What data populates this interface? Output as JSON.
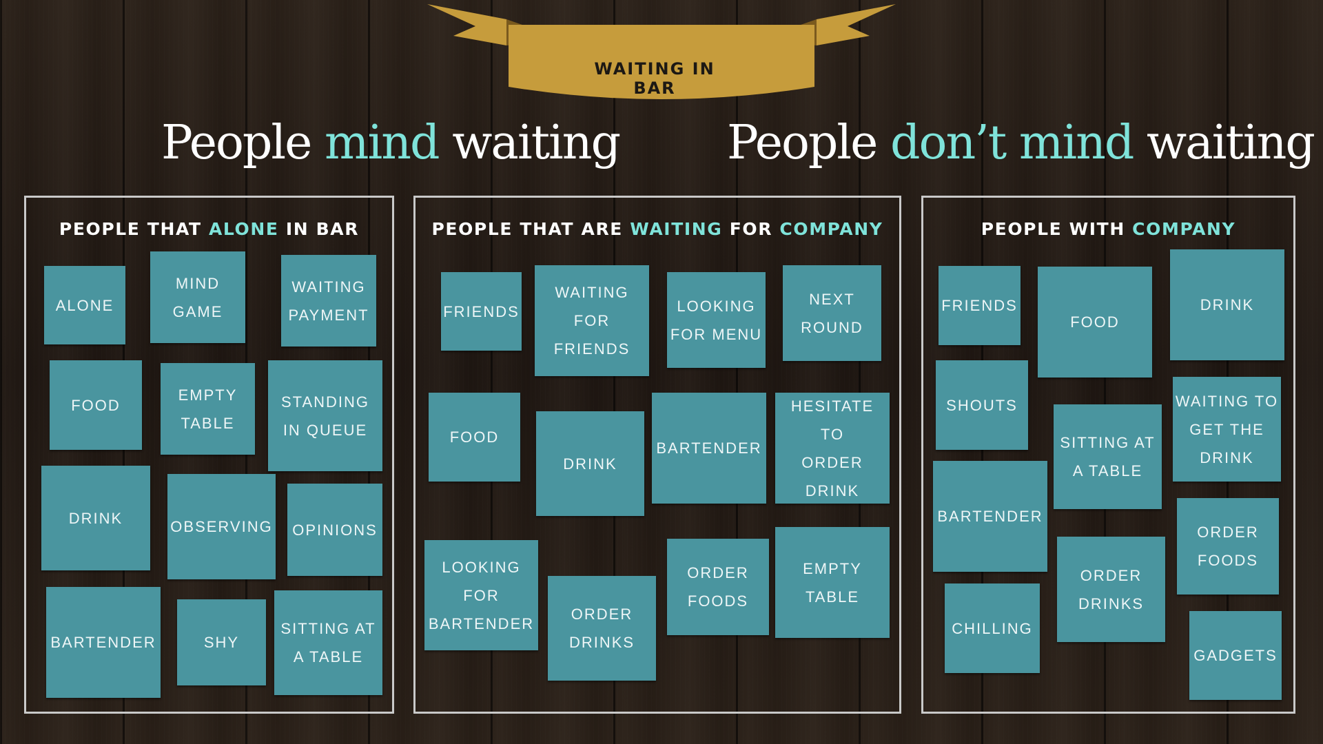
{
  "banner": {
    "label": "WAITING IN BAR",
    "color": "#c69c3c"
  },
  "headlines": {
    "left": {
      "before": "People",
      "accent": "mind",
      "after": "waiting"
    },
    "right": {
      "before": "People",
      "accent": "don’t mind",
      "after": "waiting"
    }
  },
  "colors": {
    "accent": "#7fe3da",
    "note": "#4a959f",
    "border": "#c9c9c9"
  },
  "panels": [
    {
      "title": [
        "PEOPLE THAT ",
        "ALONE",
        " IN BAR"
      ],
      "notes": [
        [
          "ALONE"
        ],
        [
          "MIND",
          "GAME"
        ],
        [
          "WAITING",
          "PAYMENT"
        ],
        [
          "FOOD"
        ],
        [
          "EMPTY",
          "TABLE"
        ],
        [
          "STANDING",
          "IN QUEUE"
        ],
        [
          "DRINK"
        ],
        [
          "OBSERVING"
        ],
        [
          "OPINIONS"
        ],
        [
          "BARTENDER"
        ],
        [
          "SHY"
        ],
        [
          "SITTING AT",
          "A TABLE"
        ]
      ]
    },
    {
      "title": [
        "PEOPLE THAT ARE ",
        "WAITING",
        " FOR ",
        "COMPANY"
      ],
      "notes": [
        [
          "FRIENDS"
        ],
        [
          "WAITING",
          "FOR",
          "FRIENDS"
        ],
        [
          "LOOKING",
          "FOR MENU"
        ],
        [
          "NEXT",
          "ROUND"
        ],
        [
          "FOOD"
        ],
        [
          "DRINK"
        ],
        [
          "BARTENDER"
        ],
        [
          "HESITATE TO",
          "ORDER",
          "DRINK"
        ],
        [
          "LOOKING",
          "FOR",
          "BARTENDER"
        ],
        [
          "ORDER",
          "DRINKS"
        ],
        [
          "ORDER",
          "FOODS"
        ],
        [
          "EMPTY",
          "TABLE"
        ]
      ]
    },
    {
      "title": [
        "PEOPLE WITH ",
        "COMPANY"
      ],
      "notes": [
        [
          "FRIENDS"
        ],
        [
          "FOOD"
        ],
        [
          "DRINK"
        ],
        [
          "SHOUTS"
        ],
        [
          "SITTING AT",
          "A TABLE"
        ],
        [
          "WAITING TO",
          "GET THE",
          "DRINK"
        ],
        [
          "BARTENDER"
        ],
        [
          "ORDER",
          "FOODS"
        ],
        [
          "CHILLING"
        ],
        [
          "ORDER",
          "DRINKS"
        ],
        [
          "GADGETS"
        ]
      ]
    }
  ]
}
